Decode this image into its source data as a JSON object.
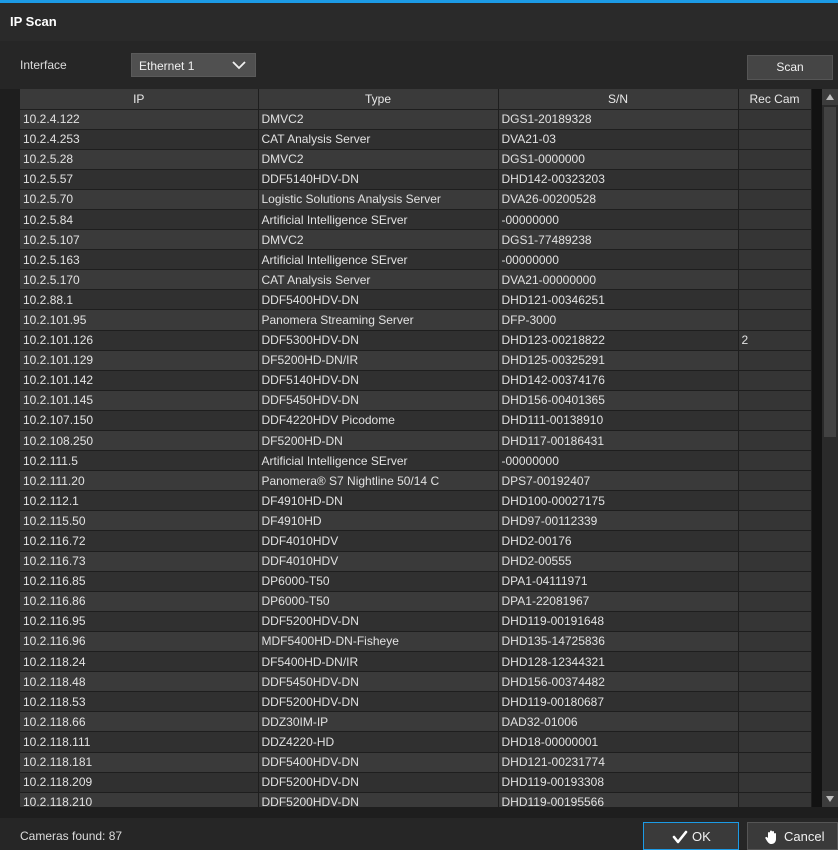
{
  "window": {
    "title": "IP Scan"
  },
  "toolbar": {
    "interface_label": "Interface",
    "interface_value": "Ethernet 1",
    "scan_label": "Scan"
  },
  "table": {
    "columns": [
      "IP",
      "Type",
      "S/N",
      "Rec Cam"
    ],
    "rows": [
      [
        "10.2.4.122",
        "DMVC2",
        "DGS1-20189328",
        ""
      ],
      [
        "10.2.4.253",
        "CAT Analysis Server",
        "DVA21-03",
        ""
      ],
      [
        "10.2.5.28",
        "DMVC2",
        "DGS1-0000000",
        ""
      ],
      [
        "10.2.5.57",
        "DDF5140HDV-DN",
        "DHD142-00323203",
        ""
      ],
      [
        "10.2.5.70",
        "Logistic Solutions Analysis Server",
        "DVA26-00200528",
        ""
      ],
      [
        "10.2.5.84",
        "Artificial Intelligence SErver",
        "-00000000",
        ""
      ],
      [
        "10.2.5.107",
        "DMVC2",
        "DGS1-77489238",
        ""
      ],
      [
        "10.2.5.163",
        "Artificial Intelligence SErver",
        "-00000000",
        ""
      ],
      [
        "10.2.5.170",
        "CAT Analysis Server",
        "DVA21-00000000",
        ""
      ],
      [
        "10.2.88.1",
        "DDF5400HDV-DN",
        "DHD121-00346251",
        ""
      ],
      [
        "10.2.101.95",
        "Panomera Streaming Server",
        "DFP-3000",
        ""
      ],
      [
        "10.2.101.126",
        "DDF5300HDV-DN",
        "DHD123-00218822",
        "2"
      ],
      [
        "10.2.101.129",
        "DF5200HD-DN/IR",
        "DHD125-00325291",
        ""
      ],
      [
        "10.2.101.142",
        "DDF5140HDV-DN",
        "DHD142-00374176",
        ""
      ],
      [
        "10.2.101.145",
        "DDF5450HDV-DN",
        "DHD156-00401365",
        ""
      ],
      [
        "10.2.107.150",
        "DDF4220HDV Picodome",
        "DHD111-00138910",
        ""
      ],
      [
        "10.2.108.250",
        "DF5200HD-DN",
        "DHD117-00186431",
        ""
      ],
      [
        "10.2.111.5",
        "Artificial Intelligence SErver",
        "-00000000",
        ""
      ],
      [
        "10.2.111.20",
        "Panomera® S7 Nightline 50/14 C",
        "DPS7-00192407",
        ""
      ],
      [
        "10.2.112.1",
        "DF4910HD-DN",
        "DHD100-00027175",
        ""
      ],
      [
        "10.2.115.50",
        "DF4910HD",
        "DHD97-00112339",
        ""
      ],
      [
        "10.2.116.72",
        "DDF4010HDV",
        "DHD2-00176",
        ""
      ],
      [
        "10.2.116.73",
        "DDF4010HDV",
        "DHD2-00555",
        ""
      ],
      [
        "10.2.116.85",
        "DP6000-T50",
        "DPA1-04111971",
        ""
      ],
      [
        "10.2.116.86",
        "DP6000-T50",
        "DPA1-22081967",
        ""
      ],
      [
        "10.2.116.95",
        "DDF5200HDV-DN",
        "DHD119-00191648",
        ""
      ],
      [
        "10.2.116.96",
        "MDF5400HD-DN-Fisheye",
        "DHD135-14725836",
        ""
      ],
      [
        "10.2.118.24",
        "DF5400HD-DN/IR",
        "DHD128-12344321",
        ""
      ],
      [
        "10.2.118.48",
        "DDF5450HDV-DN",
        "DHD156-00374482",
        ""
      ],
      [
        "10.2.118.53",
        "DDF5200HDV-DN",
        "DHD119-00180687",
        ""
      ],
      [
        "10.2.118.66",
        "DDZ30IM-IP",
        "DAD32-01006",
        ""
      ],
      [
        "10.2.118.111",
        "DDZ4220-HD",
        "DHD18-00000001",
        ""
      ],
      [
        "10.2.118.181",
        "DDF5400HDV-DN",
        "DHD121-00231774",
        ""
      ],
      [
        "10.2.118.209",
        "DDF5200HDV-DN",
        "DHD119-00193308",
        ""
      ],
      [
        "10.2.118.210",
        "DDF5200HDV-DN",
        "DHD119-00195566",
        ""
      ]
    ]
  },
  "footer": {
    "status": "Cameras found: 87",
    "ok_label": "OK",
    "cancel_label": "Cancel"
  },
  "icons": {
    "dropdown": "chevron-down-icon",
    "ok": "checkmark-icon",
    "cancel": "hand-stop-icon",
    "scroll_up": "arrow-up-icon",
    "scroll_down": "arrow-down-icon"
  },
  "colors": {
    "accent": "#1c9be6",
    "background": "#1e1e1e",
    "row_odd": "#3a3a3a",
    "row_even": "#303030"
  }
}
